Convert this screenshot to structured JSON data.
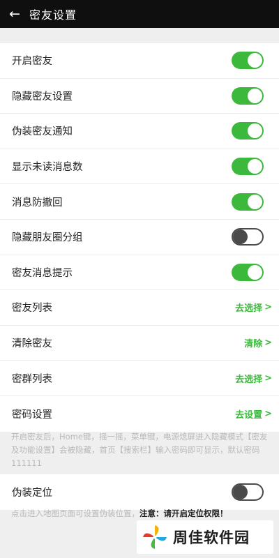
{
  "header": {
    "back_icon": "←",
    "title": "密友设置"
  },
  "settings": [
    {
      "label": "开启密友",
      "type": "toggle",
      "on": true
    },
    {
      "label": "隐藏密友设置",
      "type": "toggle",
      "on": true
    },
    {
      "label": "伪装密友通知",
      "type": "toggle",
      "on": true
    },
    {
      "label": "显示未读消息数",
      "type": "toggle",
      "on": true
    },
    {
      "label": "消息防撤回",
      "type": "toggle",
      "on": true
    },
    {
      "label": "隐藏朋友圈分组",
      "type": "toggle",
      "on": false
    },
    {
      "label": "密友消息提示",
      "type": "toggle",
      "on": true
    },
    {
      "label": "密友列表",
      "type": "action",
      "action_label": "去选择",
      "chevron": ">"
    },
    {
      "label": "清除密友",
      "type": "action",
      "action_label": "清除",
      "chevron": ">"
    },
    {
      "label": "密群列表",
      "type": "action",
      "action_label": "去选择",
      "chevron": ">"
    },
    {
      "label": "密码设置",
      "type": "action",
      "action_label": "去设置",
      "chevron": ">"
    }
  ],
  "note": "开启密友后，Home键，摇一摇，菜单键，电源熄屏进入隐藏模式【密友及功能设置】会被隐藏，首页【搜索栏】输入密码即可显示，默认密码111111",
  "fake_location": {
    "label": "伪装定位",
    "on": false
  },
  "footnote": {
    "text": "点击进入地图页面可设置伪装位置，",
    "warning": "注意：请开启定位权限！"
  },
  "watermark": {
    "text": "周佳软件园"
  },
  "colors": {
    "accent": "#3cb93d",
    "titlebar": "#0f0f0f",
    "background": "#efefef",
    "toggle_off": "#4a4a4a"
  }
}
